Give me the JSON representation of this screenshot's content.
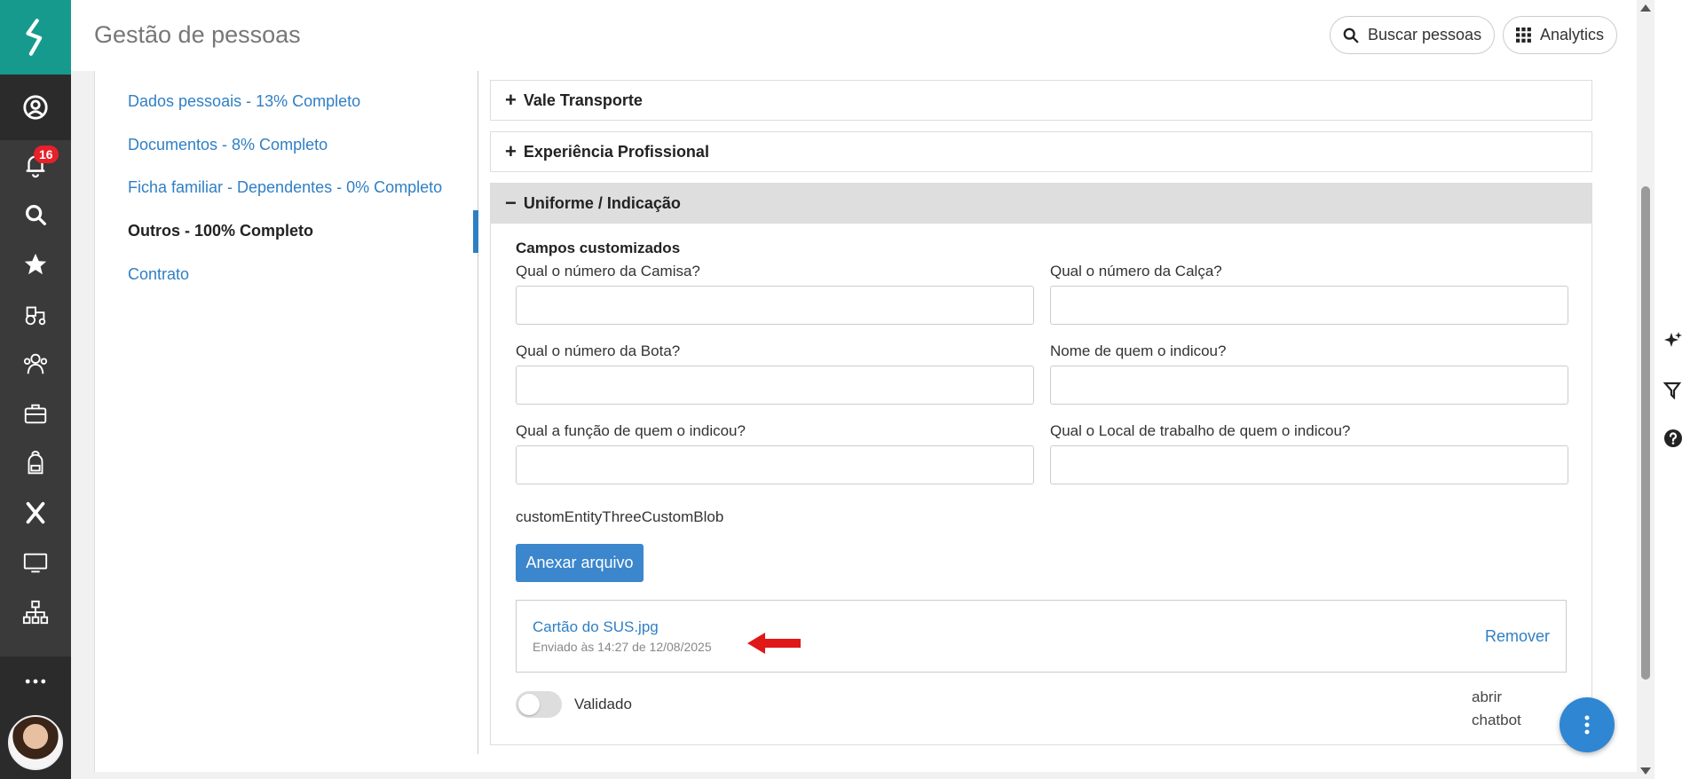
{
  "header": {
    "title": "Gestão de pessoas",
    "search_button": "Buscar pessoas",
    "analytics_button": "Analytics"
  },
  "sidebar": {
    "notification_count": "16"
  },
  "left_nav": {
    "items": [
      {
        "label": "Dados pessoais - 13% Completo"
      },
      {
        "label": "Documentos - 8% Completo"
      },
      {
        "label": "Ficha familiar - Dependentes - 0% Completo"
      },
      {
        "label": "Outros - 100% Completo"
      },
      {
        "label": "Contrato"
      }
    ],
    "active": "Outros - 100% Completo"
  },
  "sections": [
    {
      "label": "Vale Transporte",
      "sign": "+"
    },
    {
      "label": "Experiência Profissional",
      "sign": "+"
    },
    {
      "label": "Uniforme / Indicação",
      "sign": "−"
    }
  ],
  "form": {
    "subtitle": "Campos customizados",
    "fields": [
      {
        "label": "Qual o número da Camisa?",
        "value": ""
      },
      {
        "label": "Qual o número da Calça?",
        "value": ""
      },
      {
        "label": "Qual o número da Bota?",
        "value": ""
      },
      {
        "label": "Nome de quem o indicou?",
        "value": ""
      },
      {
        "label": "Qual a função de quem o indicou?",
        "value": ""
      },
      {
        "label": "Qual o Local de trabalho de quem o indicou?",
        "value": ""
      }
    ],
    "blob_label": "customEntityThreeCustomBlob",
    "attach_button": "Anexar arquivo",
    "file": {
      "name": "Cartão do SUS.jpg",
      "meta": "Enviado às 14:27 de 12/08/2025",
      "remove": "Remover"
    },
    "toggle_label": "Validado",
    "toggle_on": false
  },
  "chatbot": {
    "alt_line1": "abrir",
    "alt_line2": "chatbot"
  },
  "colors": {
    "brand_teal": "#179a8e",
    "link_blue": "#2f7fc4",
    "primary_button": "#3b86cc",
    "badge_red": "#e8202a"
  }
}
